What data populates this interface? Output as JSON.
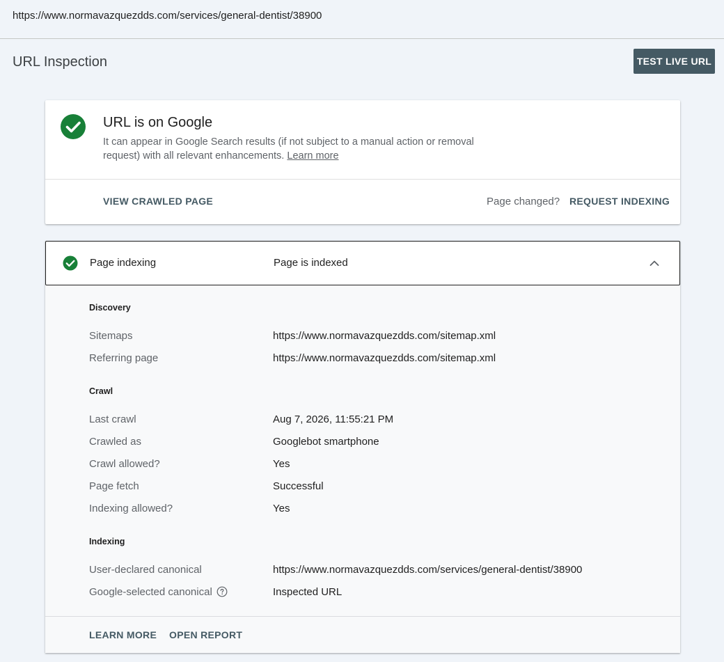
{
  "url_bar": {
    "url": "https://www.normavazquezdds.com/services/general-dentist/38900"
  },
  "header": {
    "title": "URL Inspection",
    "test_live_label": "TEST LIVE URL"
  },
  "status": {
    "title": "URL is on Google",
    "description": "It can appear in Google Search results (if not subject to a manual action or removal request) with all relevant enhancements.",
    "learn_more": "Learn more",
    "view_crawled": "VIEW CRAWLED PAGE",
    "page_changed": "Page changed?",
    "request_indexing": "REQUEST INDEXING",
    "icon": "check-circle-icon",
    "color": "#188038"
  },
  "indexing": {
    "label": "Page indexing",
    "value": "Page is indexed",
    "sections": {
      "discovery": {
        "title": "Discovery",
        "sitemaps_label": "Sitemaps",
        "sitemaps_value": "https://www.normavazquezdds.com/sitemap.xml",
        "referring_label": "Referring page",
        "referring_value": "https://www.normavazquezdds.com/sitemap.xml"
      },
      "crawl": {
        "title": "Crawl",
        "last_crawl_label": "Last crawl",
        "last_crawl_value": "Aug 7, 2026, 11:55:21 PM",
        "crawled_as_label": "Crawled as",
        "crawled_as_value": "Googlebot smartphone",
        "crawl_allowed_label": "Crawl allowed?",
        "crawl_allowed_value": "Yes",
        "page_fetch_label": "Page fetch",
        "page_fetch_value": "Successful",
        "indexing_allowed_label": "Indexing allowed?",
        "indexing_allowed_value": "Yes"
      },
      "indexing": {
        "title": "Indexing",
        "user_canonical_label": "User-declared canonical",
        "user_canonical_value": "https://www.normavazquezdds.com/services/general-dentist/38900",
        "google_canonical_label": "Google-selected canonical",
        "google_canonical_value": "Inspected URL"
      }
    },
    "footer": {
      "learn_more": "LEARN MORE",
      "open_report": "OPEN REPORT"
    }
  }
}
